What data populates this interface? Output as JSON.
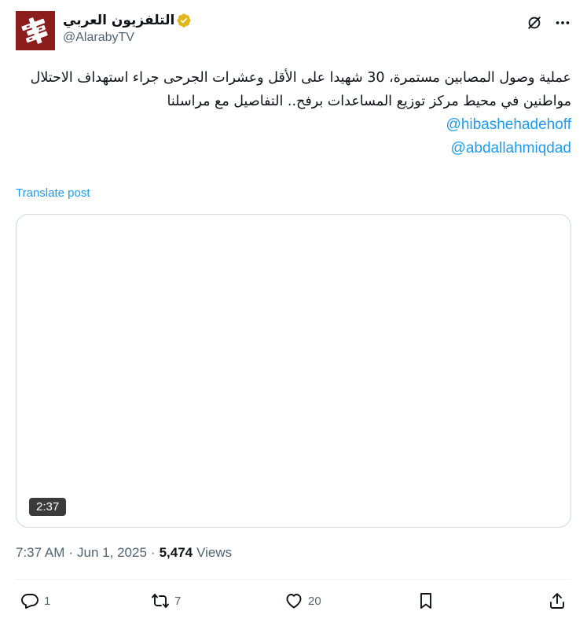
{
  "author": {
    "display_name": "التلفزيون العربي",
    "handle": "@AlarabyTV",
    "verified": true,
    "avatar_color": "#8c1d1d",
    "verified_color": "#e2b719"
  },
  "header_icons": [
    "grok-icon",
    "more-icon"
  ],
  "tweet": {
    "text": "عملية وصول المصابين مستمرة، 30 شهيدا على الأقل وعشرات الجرحى جراء استهداف الاحتلال مواطنين في محيط مركز توزيع المساعدات برفح.. التفاصيل مع مراسلنا",
    "mentions": [
      "@hibashehadehoff",
      "@abdallahmiqdad"
    ],
    "translate_label": "Translate post"
  },
  "media": {
    "duration": "2:37"
  },
  "meta": {
    "time": "7:37 AM",
    "date": "Jun 1, 2025",
    "separator": "·",
    "views_count": "5,474",
    "views_label": "Views"
  },
  "actions": {
    "replies": "1",
    "reposts": "7",
    "likes": "20"
  },
  "colors": {
    "accent": "#1d9bf0",
    "muted": "#536471",
    "text": "#0f1419",
    "border": "#cfd9de"
  }
}
